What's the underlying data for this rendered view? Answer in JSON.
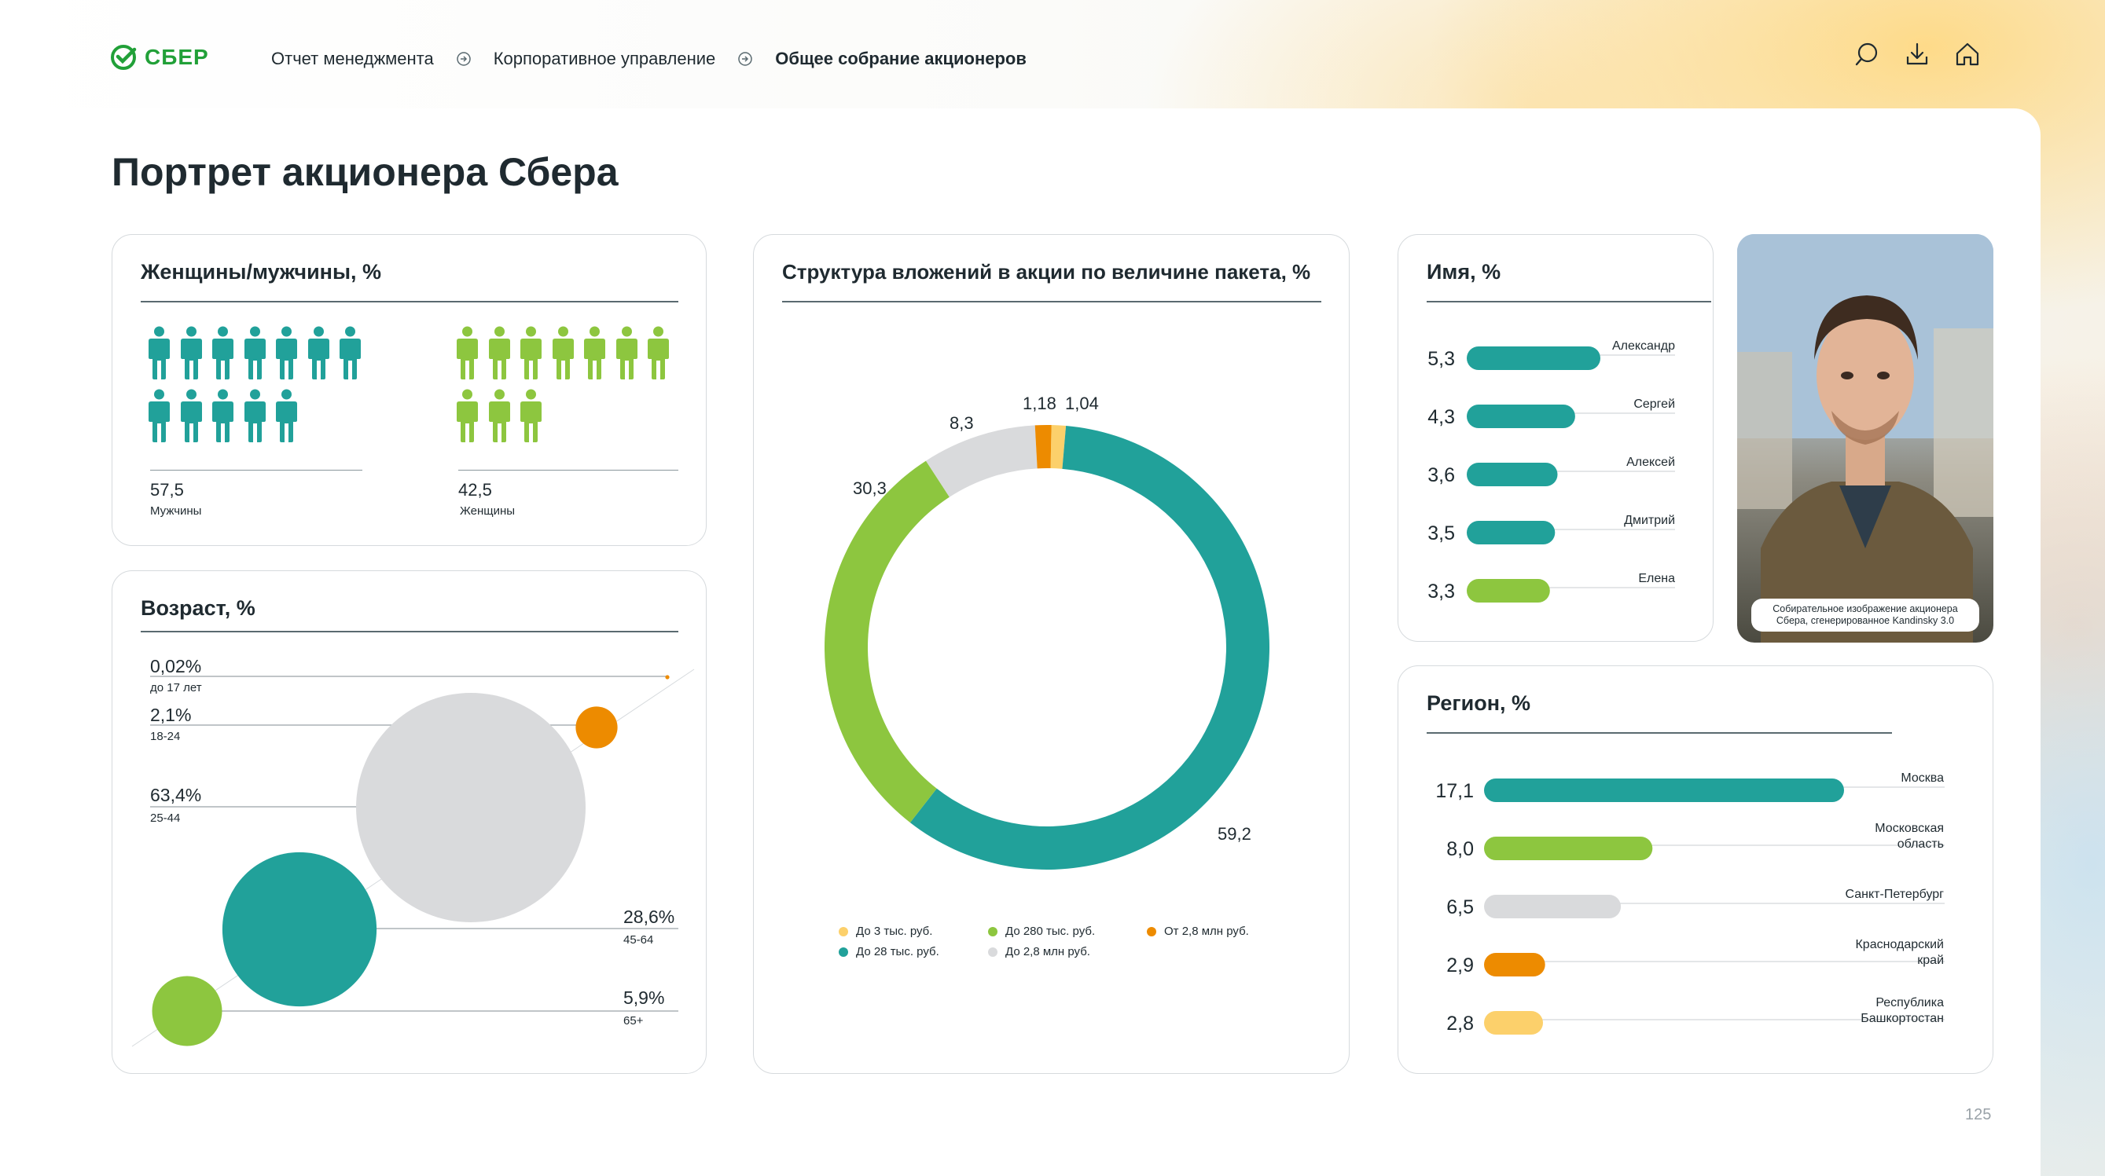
{
  "header": {
    "logo_text": "СБЕР",
    "breadcrumbs": [
      "Отчет менеджмента",
      "Корпоративное управление",
      "Общее собрание акционеров"
    ]
  },
  "icons": [
    "search-icon",
    "download-icon",
    "home-icon"
  ],
  "page": {
    "title": "Портрет акционера Сбера",
    "number": "125"
  },
  "colors": {
    "teal": "#21a19a",
    "green": "#8dc63f",
    "gray": "#d9dadc",
    "orange": "#ed8b00",
    "yellow": "#fcd06b",
    "sber": "#21a038"
  },
  "gender": {
    "title": "Женщины/мужчины, %",
    "men": {
      "value": "57,5",
      "label": "Мужчины",
      "icons": 12
    },
    "women": {
      "value": "42,5",
      "label": "Женщины",
      "icons": 10
    }
  },
  "age": {
    "title": "Возраст, %",
    "items": [
      {
        "value": "0,02%",
        "label": "до 17 лет"
      },
      {
        "value": "2,1%",
        "label": "18-24"
      },
      {
        "value": "63,4%",
        "label": "25-44"
      },
      {
        "value": "28,6%",
        "label": "45-64"
      },
      {
        "value": "5,9%",
        "label": "65+"
      }
    ]
  },
  "structure": {
    "title": "Структура вложений в акции по величине пакета, %",
    "legend": [
      "До 3 тыс. руб.",
      "До 28 тыс. руб.",
      "До 280 тыс. руб.",
      "До 2,8 млн руб.",
      "От 2,8 млн руб."
    ]
  },
  "photo": {
    "caption": "Собирательное изображение акционера Сбера, сгенерированное Kandinsky 3.0"
  },
  "chart_data": [
    {
      "type": "pie",
      "title": "Структура вложений в акции по величине пакета, %",
      "categories": [
        "До 3 тыс. руб.",
        "До 28 тыс. руб.",
        "До 280 тыс. руб.",
        "До 2,8 млн руб.",
        "От 2,8 млн руб."
      ],
      "values": [
        1.04,
        59.2,
        30.3,
        8.3,
        1.18
      ],
      "value_labels": [
        "1,04",
        "59,2",
        "30,3",
        "8,3",
        "1,18"
      ],
      "colors": [
        "#fcd06b",
        "#21a19a",
        "#8dc63f",
        "#d9dadc",
        "#ed8b00"
      ],
      "donut": true,
      "legend": "bottom"
    },
    {
      "type": "bar",
      "title": "Имя, %",
      "orientation": "horizontal",
      "categories": [
        "Александр",
        "Сергей",
        "Алексей",
        "Дмитрий",
        "Елена"
      ],
      "values": [
        5.3,
        4.3,
        3.6,
        3.5,
        3.3
      ],
      "value_labels": [
        "5,3",
        "4,3",
        "3,6",
        "3,5",
        "3,3"
      ],
      "colors": [
        "#21a19a",
        "#21a19a",
        "#21a19a",
        "#21a19a",
        "#8dc63f"
      ]
    },
    {
      "type": "bar",
      "title": "Регион, %",
      "orientation": "horizontal",
      "categories": [
        "Москва",
        "Московская\nобласть",
        "Санкт-Петербург",
        "Краснодарский\nкрай",
        "Республика\nБашкортостан"
      ],
      "values": [
        17.1,
        8.0,
        6.5,
        2.9,
        2.8
      ],
      "value_labels": [
        "17,1",
        "8,0",
        "6,5",
        "2,9",
        "2,8"
      ],
      "colors": [
        "#21a19a",
        "#8dc63f",
        "#d9dadc",
        "#ed8b00",
        "#fcd06b"
      ]
    },
    {
      "type": "scatter",
      "title": "Возраст, %",
      "categories": [
        "до 17 лет",
        "18-24",
        "25-44",
        "45-64",
        "65+"
      ],
      "values": [
        0.02,
        2.1,
        63.4,
        28.6,
        5.9
      ],
      "colors": [
        "#ed8b00",
        "#ed8b00",
        "#d9dadc",
        "#21a19a",
        "#8dc63f"
      ]
    }
  ]
}
